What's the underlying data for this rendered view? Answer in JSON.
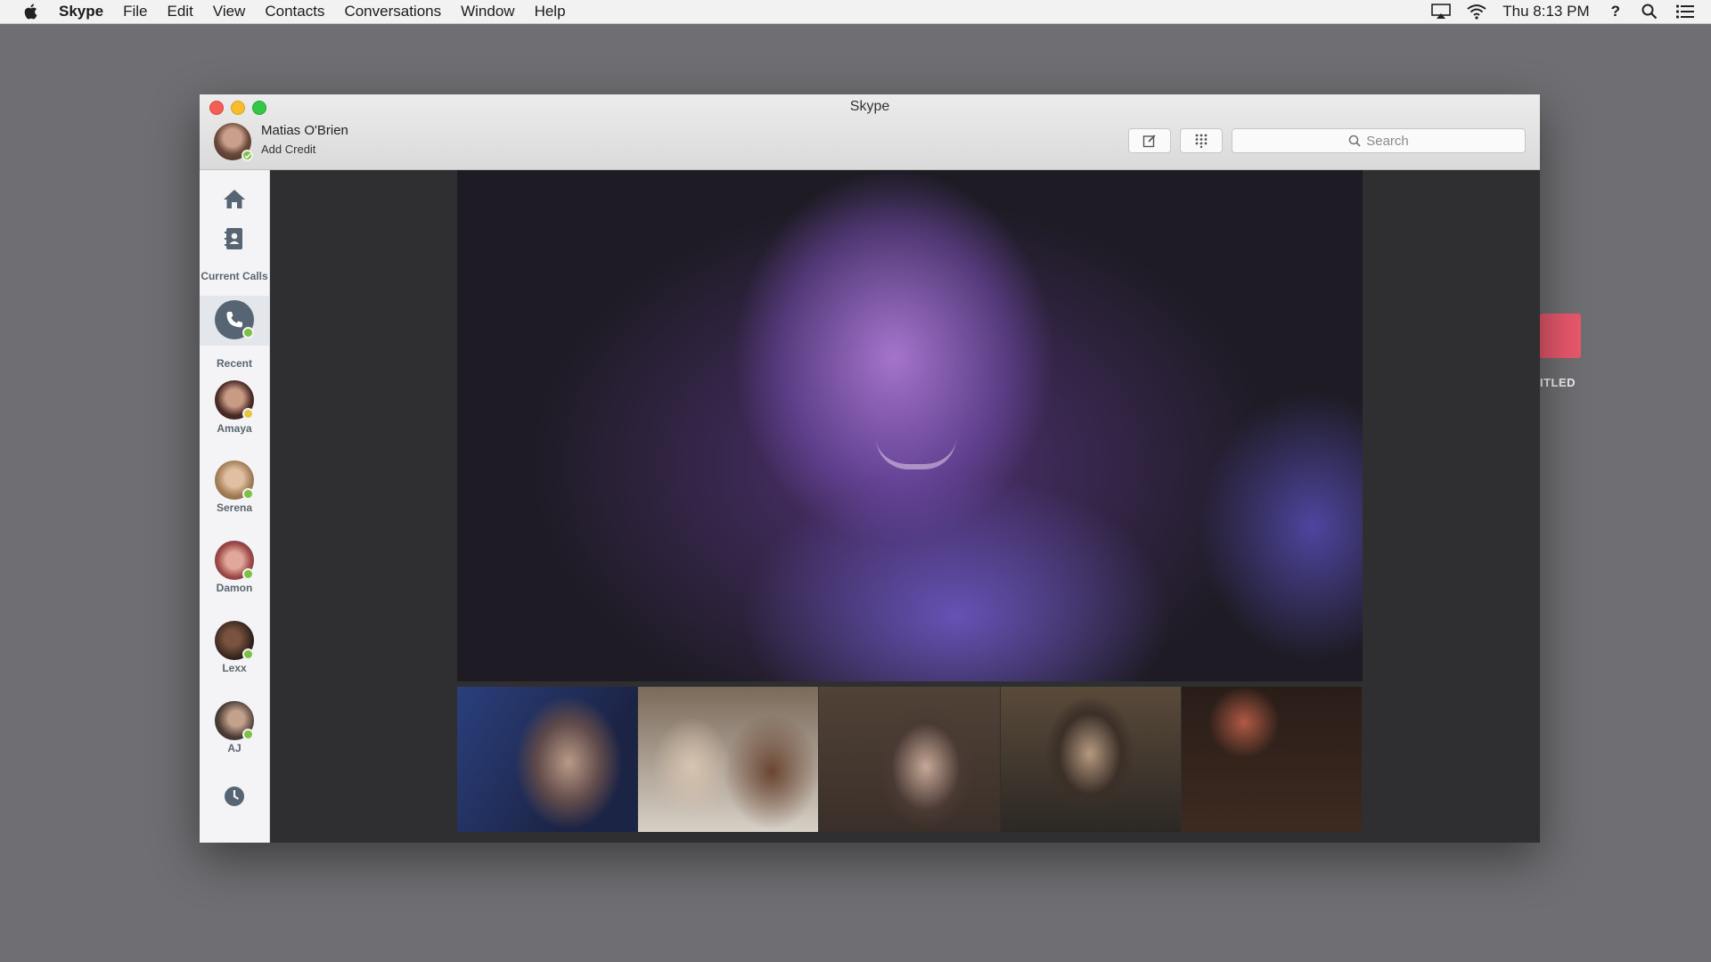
{
  "menubar": {
    "app_name": "Skype",
    "items": [
      "File",
      "Edit",
      "View",
      "Contacts",
      "Conversations",
      "Window",
      "Help"
    ],
    "clock": "Thu 8:13 PM",
    "help": "?"
  },
  "desktop": {
    "item_label": "ITLED"
  },
  "window": {
    "title": "Skype",
    "profile": {
      "name": "Matias O'Brien",
      "credit": "Add Credit"
    },
    "search_placeholder": "Search"
  },
  "sidebar": {
    "current_calls_label": "Current Calls",
    "recent_label": "Recent",
    "contacts": [
      {
        "name": "Amaya",
        "status": "away"
      },
      {
        "name": "Serena",
        "status": "online"
      },
      {
        "name": "Damon",
        "status": "online"
      },
      {
        "name": "Lexx",
        "status": "online"
      },
      {
        "name": "AJ",
        "status": "online"
      }
    ]
  },
  "colors": {
    "online": "#7cc143",
    "away": "#e6c63a",
    "call_button": "#566473"
  },
  "icons": {
    "home": "home-icon",
    "contacts": "contacts-book-icon",
    "call": "phone-icon",
    "history": "clock-icon",
    "compose": "compose-icon",
    "dialpad": "dialpad-icon",
    "search": "search-icon"
  }
}
